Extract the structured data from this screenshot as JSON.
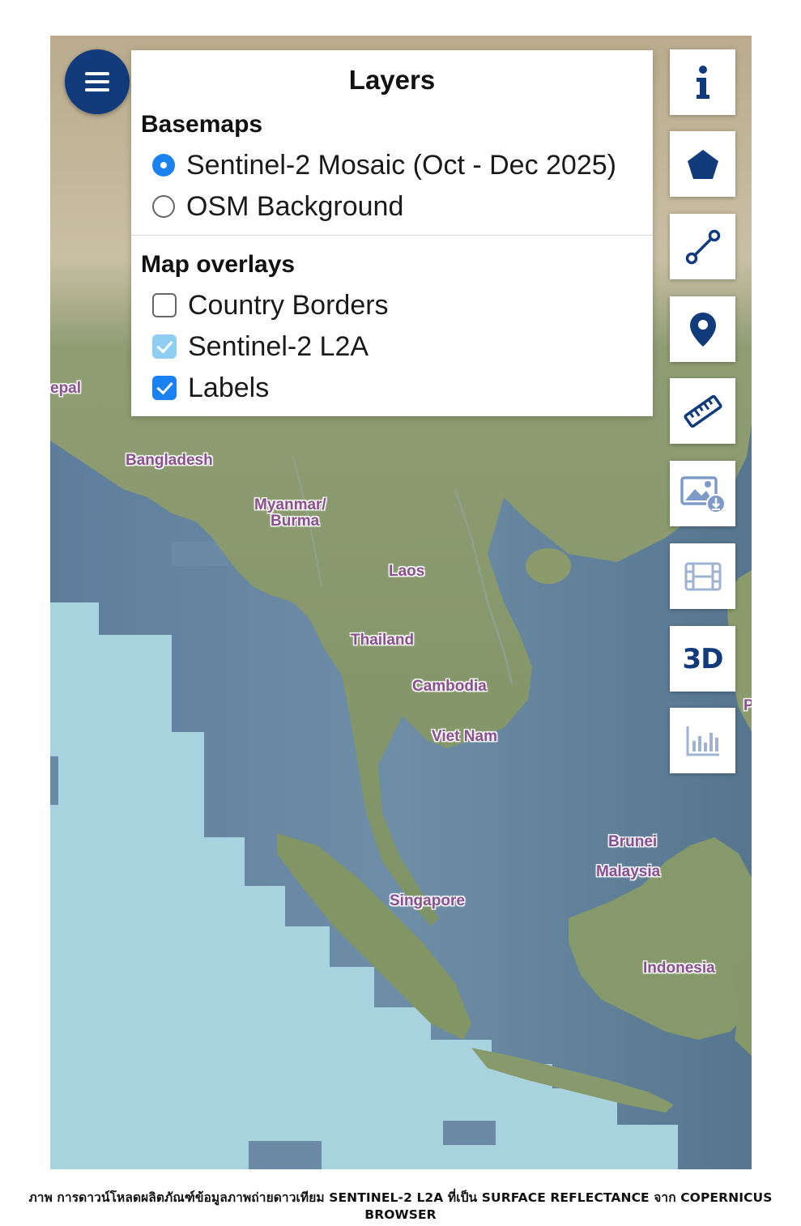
{
  "panel": {
    "title": "Layers",
    "basemaps_title": "Basemaps",
    "basemaps": [
      {
        "label": "Sentinel-2 Mosaic (Oct - Dec 2025)",
        "selected": true
      },
      {
        "label": "OSM Background",
        "selected": false
      }
    ],
    "overlays_title": "Map overlays",
    "overlays": [
      {
        "label": "Country Borders",
        "checked": false
      },
      {
        "label": "Sentinel-2 L2A",
        "checked": true,
        "dimmed": true
      },
      {
        "label": "Labels",
        "checked": true
      }
    ]
  },
  "map": {
    "labels": {
      "nepal": "epal",
      "bangladesh": "Bangladesh",
      "myanmar_1": "Myanmar/",
      "myanmar_2": "Burma",
      "laos": "Laos",
      "thailand": "Thailand",
      "cambodia": "Cambodia",
      "vietnam": "Viet Nam",
      "brunei": "Brunei",
      "malaysia": "Malaysia",
      "singapore": "Singapore",
      "indonesia": "Indonesia",
      "edge_p": "P"
    },
    "colors": {
      "sea": "#a9d2df",
      "land": "#8a9a6c",
      "imagery": "#5e7f9e"
    }
  },
  "toolbar": {
    "tools": [
      {
        "name": "info",
        "icon": "info-icon"
      },
      {
        "name": "polygon",
        "icon": "pentagon-icon"
      },
      {
        "name": "line",
        "icon": "line-measure-icon"
      },
      {
        "name": "pin",
        "icon": "location-pin-icon"
      },
      {
        "name": "ruler",
        "icon": "ruler-icon"
      },
      {
        "name": "image-download",
        "icon": "image-download-icon"
      },
      {
        "name": "timelapse",
        "icon": "film-icon"
      },
      {
        "name": "3d",
        "icon": "3d-icon",
        "label": "3D"
      },
      {
        "name": "histogram",
        "icon": "histogram-icon"
      }
    ],
    "accent": "#123b7c"
  },
  "caption": "ภาพ การดาวน์โหลดผลิตภัณฑ์ข้อมูลภาพถ่ายดาวเทียม SENTINEL-2 L2A ที่เป็น SURFACE REFLECTANCE จาก COPERNICUS BROWSER"
}
